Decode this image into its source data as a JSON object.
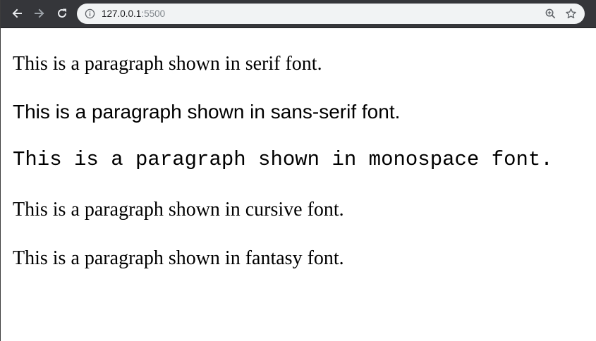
{
  "browser": {
    "url_host": "127.0.0.1",
    "url_port": ":5500",
    "icons": {
      "back": "arrow-left-icon",
      "forward": "arrow-right-icon",
      "reload": "reload-icon",
      "site_info": "info-icon",
      "zoom": "zoom-icon",
      "bookmark": "star-icon"
    },
    "colors": {
      "toolbar": "#35363a",
      "omnibox": "#f1f3f4",
      "port_text": "#80868b"
    }
  },
  "page": {
    "paragraphs": [
      "This is a paragraph shown in serif font.",
      "This is a paragraph shown in sans-serif font.",
      "This is a paragraph shown in monospace font.",
      "This is a paragraph shown in cursive font.",
      "This is a paragraph shown in fantasy font."
    ]
  }
}
